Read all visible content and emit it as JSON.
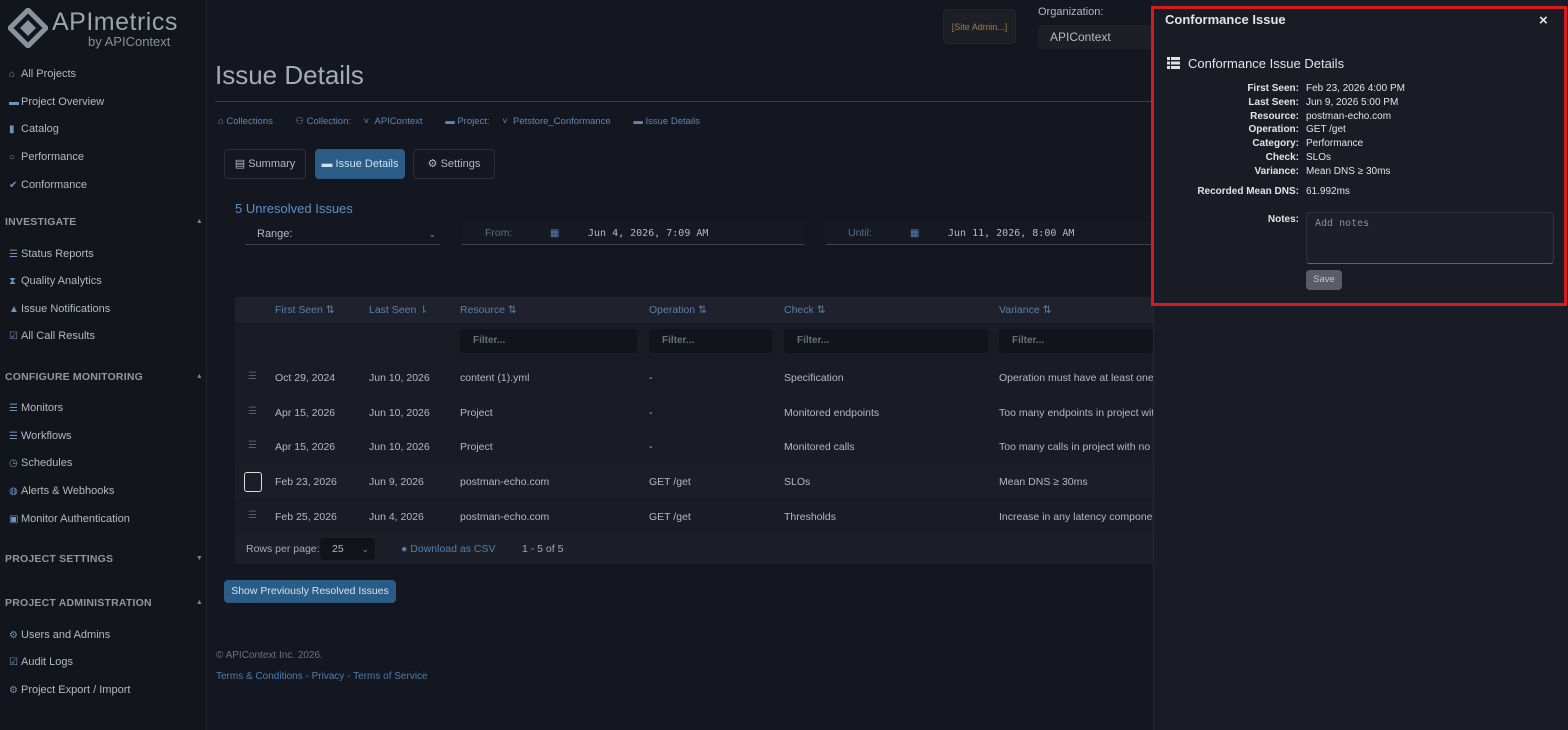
{
  "brand": {
    "name": "APImetrics",
    "byline": "by APIContext"
  },
  "sidebar": {
    "top_items": [
      {
        "label": "All Projects",
        "icon": "home-icon"
      },
      {
        "label": "Project Overview",
        "icon": "folder-icon"
      },
      {
        "label": "Catalog",
        "icon": "book-icon"
      },
      {
        "label": "Performance",
        "icon": "gauge-icon"
      },
      {
        "label": "Conformance",
        "icon": "check-icon"
      }
    ],
    "investigate": {
      "title": "INVESTIGATE",
      "items": [
        {
          "label": "Status Reports",
          "icon": "list-icon"
        },
        {
          "label": "Quality Analytics",
          "icon": "hourglass-icon"
        },
        {
          "label": "Issue Notifications",
          "icon": "bell-icon"
        },
        {
          "label": "All Call Results",
          "icon": "check-square-icon"
        }
      ]
    },
    "configure": {
      "title": "CONFIGURE MONITORING",
      "items": [
        {
          "label": "Monitors",
          "icon": "list-icon"
        },
        {
          "label": "Workflows",
          "icon": "list-icon"
        },
        {
          "label": "Schedules",
          "icon": "clock-icon"
        },
        {
          "label": "Alerts & Webhooks",
          "icon": "globe-icon"
        },
        {
          "label": "Monitor Authentication",
          "icon": "lock-icon"
        }
      ]
    },
    "project_settings": {
      "title": "PROJECT SETTINGS"
    },
    "administration": {
      "title": "PROJECT ADMINISTRATION",
      "items": [
        {
          "label": "Users and Admins",
          "icon": "gear-icon"
        },
        {
          "label": "Audit Logs",
          "icon": "check-square-icon"
        },
        {
          "label": "Project Export / Import",
          "icon": "gear-icon"
        }
      ]
    }
  },
  "topbar": {
    "site_admin": "[Site Admin...]",
    "org_label": "Organization:",
    "org_value": "APIContext"
  },
  "page": {
    "title": "Issue Details",
    "breadcrumbs": {
      "collections": "Collections",
      "collection_label": "Collection:",
      "collection_value": "APIContext",
      "project_label": "Project:",
      "project_value": "Petstore_Conformance",
      "current": "Issue Details"
    },
    "tabs": [
      "Summary",
      "Issue Details",
      "Settings"
    ],
    "unresolved": "5 Unresolved Issues",
    "range_label": "Range:",
    "from_label": "From:",
    "from_value": "Jun 4, 2026, 7:09 AM",
    "until_label": "Until:",
    "until_value": "Jun 11, 2026, 8:00 AM"
  },
  "table": {
    "columns": [
      "First Seen",
      "Last Seen",
      "Resource",
      "Operation",
      "Check",
      "Variance"
    ],
    "filter_placeholder": "Filter...",
    "rows": [
      [
        "Oct 29, 2024",
        "Jun 10, 2026",
        "content (1).yml",
        "-",
        "Specification",
        "Operation must have at least one"
      ],
      [
        "Apr 15, 2026",
        "Jun 10, 2026",
        "Project",
        "-",
        "Monitored endpoints",
        "Too many endpoints in project with"
      ],
      [
        "Apr 15, 2026",
        "Jun 10, 2026",
        "Project",
        "-",
        "Monitored calls",
        "Too many calls in project with no r"
      ],
      [
        "Feb 23, 2026",
        "Jun 9, 2026",
        "postman-echo.com",
        "GET /get",
        "SLOs",
        "Mean DNS ≥ 30ms"
      ],
      [
        "Feb 25, 2026",
        "Jun 4, 2026",
        "postman-echo.com",
        "GET /get",
        "Thresholds",
        "Increase in any latency componen"
      ]
    ],
    "rows_per_page_label": "Rows per page:",
    "rows_per_page": "25",
    "download_csv": "Download as CSV",
    "pager": "1 - 5 of 5"
  },
  "show_resolved": "Show Previously Resolved Issues",
  "footer": {
    "copyright": "© APIContext Inc. 2026.",
    "terms": "Terms & Conditions",
    "privacy": "Privacy",
    "tos": "Terms of Service",
    "sep": "-"
  },
  "panel": {
    "title": "Conformance Issue",
    "subtitle": "Conformance Issue Details",
    "fields": [
      {
        "label": "First Seen:",
        "value": "Feb 23, 2026 4:00 PM"
      },
      {
        "label": "Last Seen:",
        "value": "Jun 9, 2026 5:00 PM"
      },
      {
        "label": "Resource:",
        "value": "postman-echo.com"
      },
      {
        "label": "Operation:",
        "value": "GET /get"
      },
      {
        "label": "Category:",
        "value": "Performance"
      },
      {
        "label": "Check:",
        "value": "SLOs"
      },
      {
        "label": "Variance:",
        "value": "Mean DNS ≥ 30ms"
      }
    ],
    "recorded_label": "Recorded Mean DNS:",
    "recorded_value": "61.992ms",
    "notes_label": "Notes:",
    "notes_placeholder": "Add notes",
    "save": "Save",
    "close": "×"
  },
  "colors": {
    "accent": "#2a5c86",
    "highlight_border": "#d11d1d",
    "link": "#5e87b8"
  }
}
